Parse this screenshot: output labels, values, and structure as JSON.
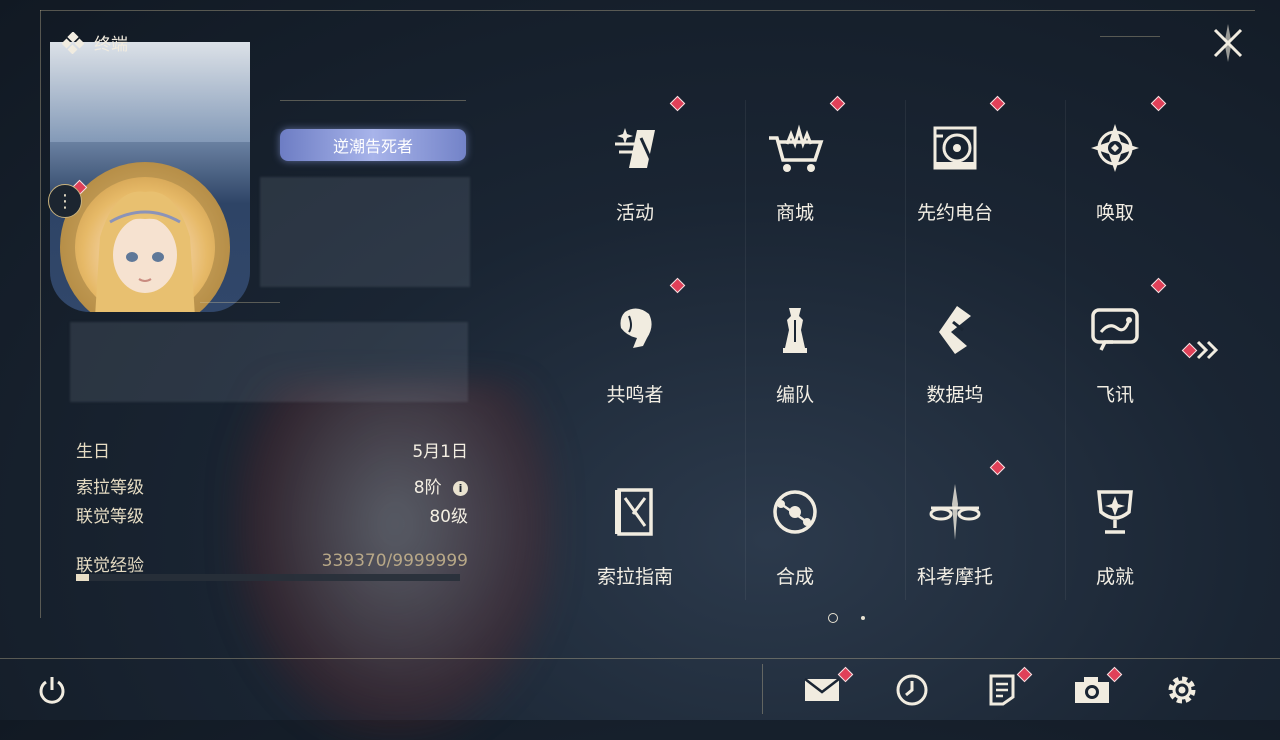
{
  "window": {
    "title": "终端"
  },
  "profile": {
    "title_badge": "逆潮告死者",
    "stats": [
      {
        "label": "生日",
        "value": "5月1日"
      },
      {
        "label": "索拉等级",
        "value": "8阶"
      },
      {
        "label": "联觉等级",
        "value": "80级"
      },
      {
        "label": "联觉经验",
        "value": "339370/9999999"
      }
    ],
    "exp_fraction": 0.034
  },
  "grid": {
    "items": [
      {
        "label": "活动",
        "icon": "activity-icon",
        "badge": true
      },
      {
        "label": "商城",
        "icon": "shop-icon",
        "badge": true
      },
      {
        "label": "先约电台",
        "icon": "radio-icon",
        "badge": true
      },
      {
        "label": "唤取",
        "icon": "summon-icon",
        "badge": true
      },
      {
        "label": "共鸣者",
        "icon": "resonator-icon",
        "badge": true
      },
      {
        "label": "编队",
        "icon": "team-icon",
        "badge": false
      },
      {
        "label": "数据坞",
        "icon": "data-dock-icon",
        "badge": false
      },
      {
        "label": "飞讯",
        "icon": "message-icon",
        "badge": true
      },
      {
        "label": "索拉指南",
        "icon": "guide-icon",
        "badge": false
      },
      {
        "label": "合成",
        "icon": "synthesis-icon",
        "badge": false
      },
      {
        "label": "科考摩托",
        "icon": "motorcycle-icon",
        "badge": true
      },
      {
        "label": "成就",
        "icon": "achievement-icon",
        "badge": false
      }
    ]
  },
  "pagination": {
    "current": 1,
    "total": 2
  },
  "bottom_bar": {
    "buttons": [
      "power-icon",
      "mail-icon",
      "clock-icon",
      "notice-icon",
      "camera-icon",
      "settings-icon"
    ]
  },
  "colors": {
    "badge": "#e04058",
    "accent": "#d7c8a0",
    "background": "#1a2533"
  }
}
